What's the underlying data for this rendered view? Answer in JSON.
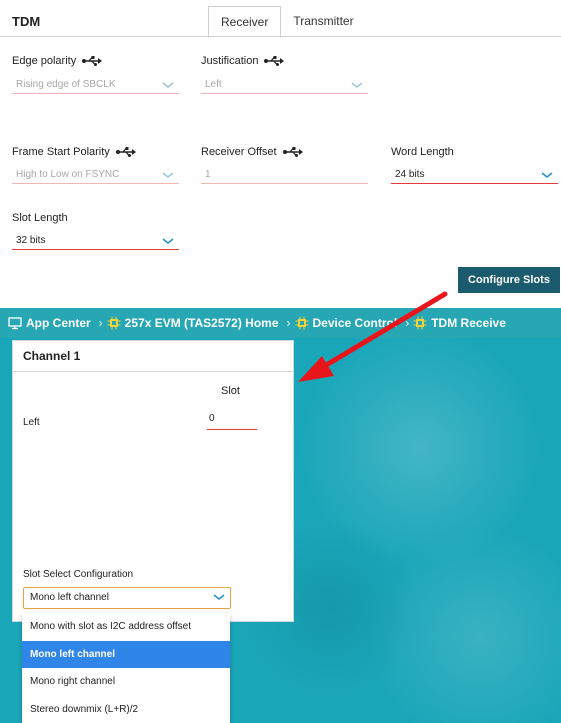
{
  "panel": {
    "title": "TDM",
    "tabs": [
      {
        "label": "Receiver",
        "active": true
      },
      {
        "label": "Transmitter",
        "active": false
      }
    ]
  },
  "fields": {
    "edge_polarity": {
      "label": "Edge polarity",
      "value": "Rising edge of SBCLK"
    },
    "justification": {
      "label": "Justification",
      "value": "Left"
    },
    "frame_start_polarity": {
      "label": "Frame Start Polarity",
      "value": "High to Low on FSYNC"
    },
    "receiver_offset": {
      "label": "Receiver Offset",
      "value": "1"
    },
    "word_length": {
      "label": "Word Length",
      "value": "24 bits"
    },
    "slot_length": {
      "label": "Slot Length",
      "value": "32 bits"
    }
  },
  "configure_button": "Configure Slots",
  "breadcrumb": [
    {
      "label": "App Center",
      "icon": "monitor-icon"
    },
    {
      "label": "257x EVM (TAS2572) Home",
      "icon": "chip-icon"
    },
    {
      "label": "Device Control",
      "icon": "chip-icon"
    },
    {
      "label": "TDM Receive",
      "icon": "chip-icon"
    }
  ],
  "dialog": {
    "title": "Channel 1",
    "column_header": "Slot",
    "row_label": "Left",
    "slot_value": "0",
    "slot_select_label": "Slot Select Configuration",
    "slot_select_value": "Mono left channel",
    "options": [
      {
        "label": "Mono with slot as I2C address offset",
        "selected": false
      },
      {
        "label": "Mono left channel",
        "selected": true
      },
      {
        "label": "Mono right channel",
        "selected": false
      },
      {
        "label": "Stereo downmix (L+R)/2",
        "selected": false
      }
    ]
  },
  "colors": {
    "accent_red": "#e23a3a",
    "button_teal": "#1c5a6e",
    "teal_background": "#1aa6b9",
    "selected_blue": "#2f85e8",
    "select_border": "#e8a245"
  }
}
